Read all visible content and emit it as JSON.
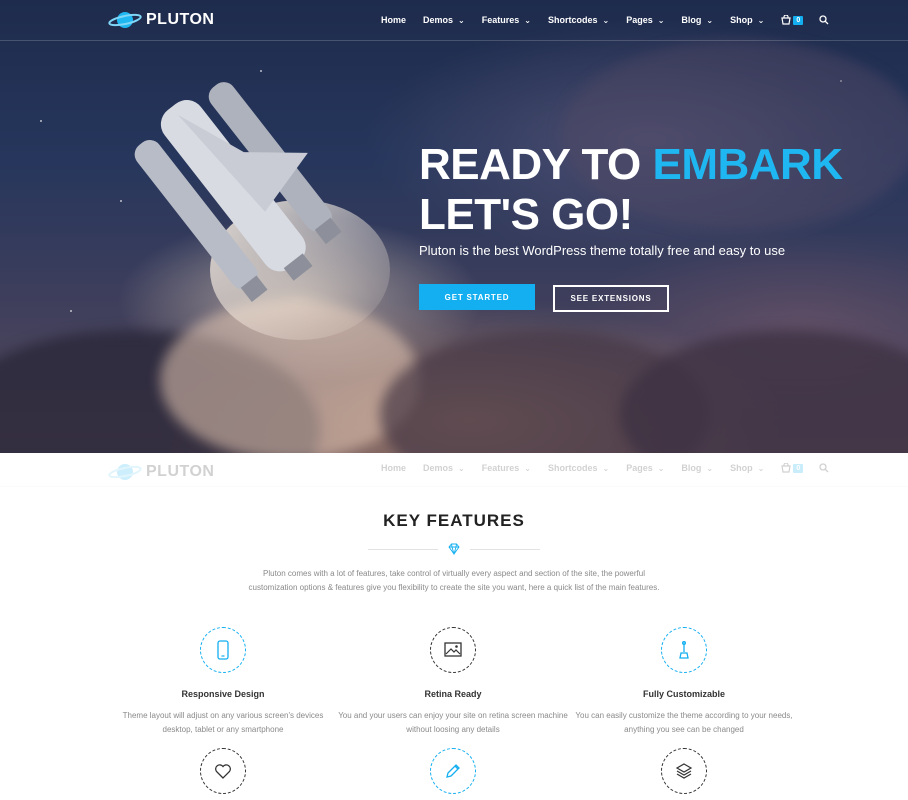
{
  "brand": {
    "name": "PLUTON"
  },
  "nav": {
    "items": [
      {
        "label": "Home",
        "dropdown": false
      },
      {
        "label": "Demos",
        "dropdown": true
      },
      {
        "label": "Features",
        "dropdown": true
      },
      {
        "label": "Shortcodes",
        "dropdown": true
      },
      {
        "label": "Pages",
        "dropdown": true
      },
      {
        "label": "Blog",
        "dropdown": true
      },
      {
        "label": "Shop",
        "dropdown": true
      }
    ],
    "cart_count": "0",
    "icons": {
      "cart": "cart-icon",
      "search": "search-icon"
    }
  },
  "hero": {
    "title_part1": "READY TO ",
    "title_accent": "EMBARK",
    "title_line2": "LET'S GO!",
    "subtitle": "Pluton is the best WordPress theme totally free and easy to use",
    "primary_button": "GET STARTED",
    "secondary_button": "SEE EXTENSIONS"
  },
  "features": {
    "title": "KEY FEATURES",
    "description": "Pluton comes with a lot of features, take control of virtually every aspect and section of the site, the powerful customization options & features give you flexibility to create the site you want, here a quick list of the main features.",
    "items": [
      {
        "icon": "mobile-icon",
        "title": "Responsive Design",
        "text": "Theme layout will adjust on any various screen's devices desktop, tablet or any smartphone"
      },
      {
        "icon": "image-icon",
        "title": "Retina Ready",
        "text": "You and your users can enjoy your site on retina screen machine without loosing any details"
      },
      {
        "icon": "tool-icon",
        "title": "Fully Customizable",
        "text": "You can easily customize the theme according to your needs, anything you see can be changed"
      },
      {
        "icon": "heart-icon",
        "title": "",
        "text": ""
      },
      {
        "icon": "pencil-icon",
        "title": "",
        "text": ""
      },
      {
        "icon": "layers-icon",
        "title": "",
        "text": ""
      }
    ]
  },
  "colors": {
    "accent": "#13aff0",
    "accent_text": "#1fb7f2"
  }
}
